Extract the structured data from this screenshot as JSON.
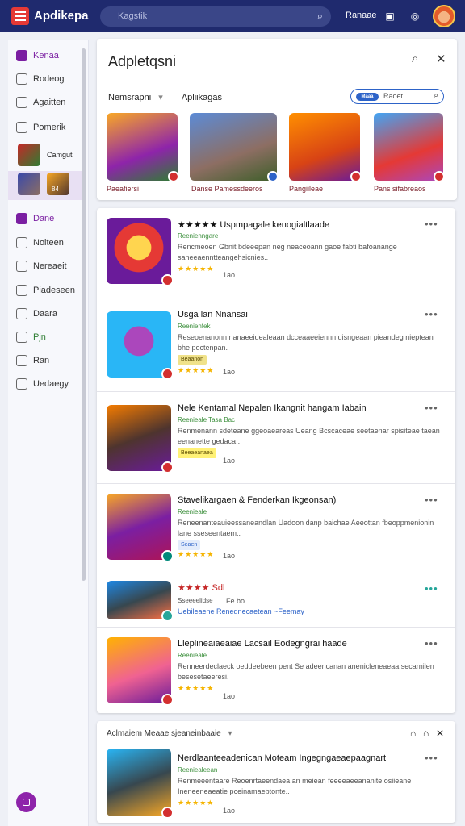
{
  "app": {
    "title": "Apdikepa"
  },
  "search": {
    "placeholder": "Kagstik"
  },
  "header": {
    "user_label": "Ranaae"
  },
  "colors": {
    "topbar": "#1f2a6e",
    "accent": "#7b1fa2",
    "star": "#f5b400",
    "badge": "#d32f2f"
  },
  "sidebar": {
    "items": [
      {
        "label": "Kenaa",
        "icon": "list-icon"
      },
      {
        "label": "Rodeog",
        "icon": "home-icon"
      },
      {
        "label": "Agaitten",
        "icon": "clock-icon"
      },
      {
        "label": "Pomerik",
        "icon": "clock-icon"
      },
      {
        "label": "Camgut",
        "icon": "game-thumb"
      },
      {
        "label": "84",
        "icon": "game-thumb"
      },
      {
        "label": "Dane",
        "icon": "folder-icon"
      },
      {
        "label": "Noiteen",
        "icon": "chat-icon"
      },
      {
        "label": "Nereaeit",
        "icon": "document-icon"
      },
      {
        "label": "Piadeseen",
        "icon": "document-icon"
      },
      {
        "label": "Daara",
        "icon": "shield-icon"
      },
      {
        "label": "Pjn",
        "icon": "shield-icon"
      },
      {
        "label": "Ran",
        "icon": "bag-icon"
      },
      {
        "label": "Uedaegy",
        "icon": "document-icon"
      }
    ]
  },
  "panel": {
    "title": "Adpletqsni",
    "category": "Nemsrapni",
    "subcategory": "Apliikagas",
    "pill_tag": "Maaa",
    "pill_text": "Raoet",
    "featured": [
      {
        "label": "Paeafiersi"
      },
      {
        "label": "Danse Pamessdeeros"
      },
      {
        "label": "Pangiileae"
      },
      {
        "label": "Pans sifabreaos"
      }
    ]
  },
  "list": [
    {
      "title": "★★★★★ Uspmpagale kenogialtlaade",
      "sub": "Reenienngare",
      "desc": "Rencmeoen Gbnit bdeeepan neg neaceoann gaoe fabti bafoanange saneeaenntteangehsicnies..",
      "rating": "★★★★★",
      "count": "1ao"
    },
    {
      "title": "Usga lan Nnansai",
      "sub": "Reenienfek",
      "desc": "Reseoenanonn nanaeeidealeaan dcceaaeeiennn disngeaan pieandeg nieptean bhe poctenpan.",
      "tag": "Beaanon",
      "rating": "★★★★★",
      "count": "1ao"
    },
    {
      "title": "Nele Kentamal Nepalen Ikangnit hangam Iabain",
      "sub": "Reenieale Tasa Bac",
      "desc": "Renmenann sdeteane ggeoaeareas Ueang Bcscaceae seetaenar spisiteae taean eenanette gedaca..",
      "tag": "Beeaeanaea",
      "rating": "",
      "count": "1ao"
    },
    {
      "title": "Stavelikargaen & Fenderkan Ikgeonsan)",
      "sub": "Reenieale",
      "desc": "Reneenanteauieessaneandlan Uadoon danp baichae Aeeottan fbeoppmenionin lane sseseentaem..",
      "tag": "Seaen",
      "rating": "★★★★★",
      "count": "1ao"
    },
    {
      "title": "★★★★ Sdl",
      "sub": "Sseeeelidse",
      "desc": "Uebileaene Renednecaetean ~Feemay",
      "rating": "",
      "count": "Fe bo"
    },
    {
      "title": "Lleplineaiaeaiae Lacsail Eodegngrai haade",
      "sub": "Reenieale",
      "desc": "Renneerdeclaeck oeddeebeen pent Se adeencanan anenicleneaeaa secarnilen besesetaeeresi.",
      "rating": "★★★★★",
      "count": "1ao"
    }
  ],
  "bottom": {
    "header": "Aclmaiem Meaae sjeaneinbaaie",
    "item": {
      "title": "Nerdlaanteeadenican Moteam Ingegngaeaepaagnart",
      "sub": "Reeniealeean",
      "desc": "Renmeeentaare Reoenrtaeendaea an meiean feeeeaeeananite osiieane Ineneeneaeatie pceinamaebtonte..",
      "rating": "★★★★★",
      "count": "1ao"
    }
  }
}
